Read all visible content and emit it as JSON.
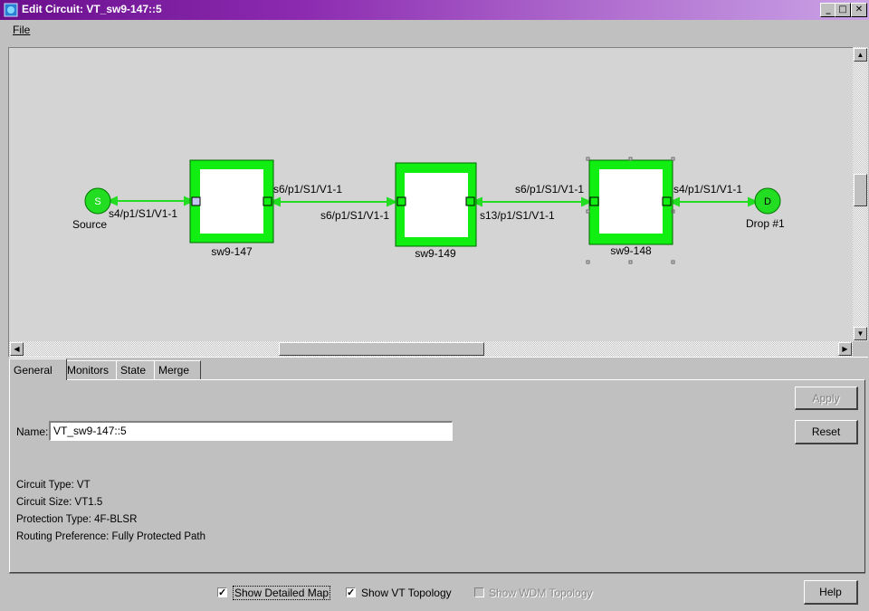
{
  "window": {
    "title": "Edit Circuit: VT_sw9-147::5"
  },
  "menu": {
    "file": "File"
  },
  "map": {
    "source": {
      "letter": "S",
      "label": "Source",
      "port": "s4/p1/S1/V1-1"
    },
    "drop": {
      "letter": "D",
      "label": "Drop #1",
      "port": "s4/p1/S1/V1-1"
    },
    "nodes": [
      {
        "name": "sw9-147",
        "out_port": "s6/p1/S1/V1-1"
      },
      {
        "name": "sw9-149",
        "in_port": "s6/p1/S1/V1-1",
        "out_port": "s13/p1/S1/V1-1"
      },
      {
        "name": "sw9-148",
        "in_port": "s6/p1/S1/V1-1"
      }
    ],
    "link_color": "#22dd22",
    "node_color": "#11ee11"
  },
  "tabs": [
    "General",
    "Monitors",
    "State",
    "Merge"
  ],
  "general": {
    "name_label": "Name:",
    "name_value": "VT_sw9-147::5",
    "apply": "Apply",
    "reset": "Reset",
    "circuit_type": "Circuit Type:  VT",
    "circuit_size": "Circuit Size: VT1.5",
    "protection_type": "Protection Type:  4F-BLSR",
    "routing_preference": "Routing Preference: Fully Protected Path"
  },
  "footer": {
    "show_detailed_map": "Show Detailed Map",
    "show_vt_topology": "Show VT Topology",
    "show_wdm_topology": "Show WDM Topology",
    "help": "Help"
  }
}
